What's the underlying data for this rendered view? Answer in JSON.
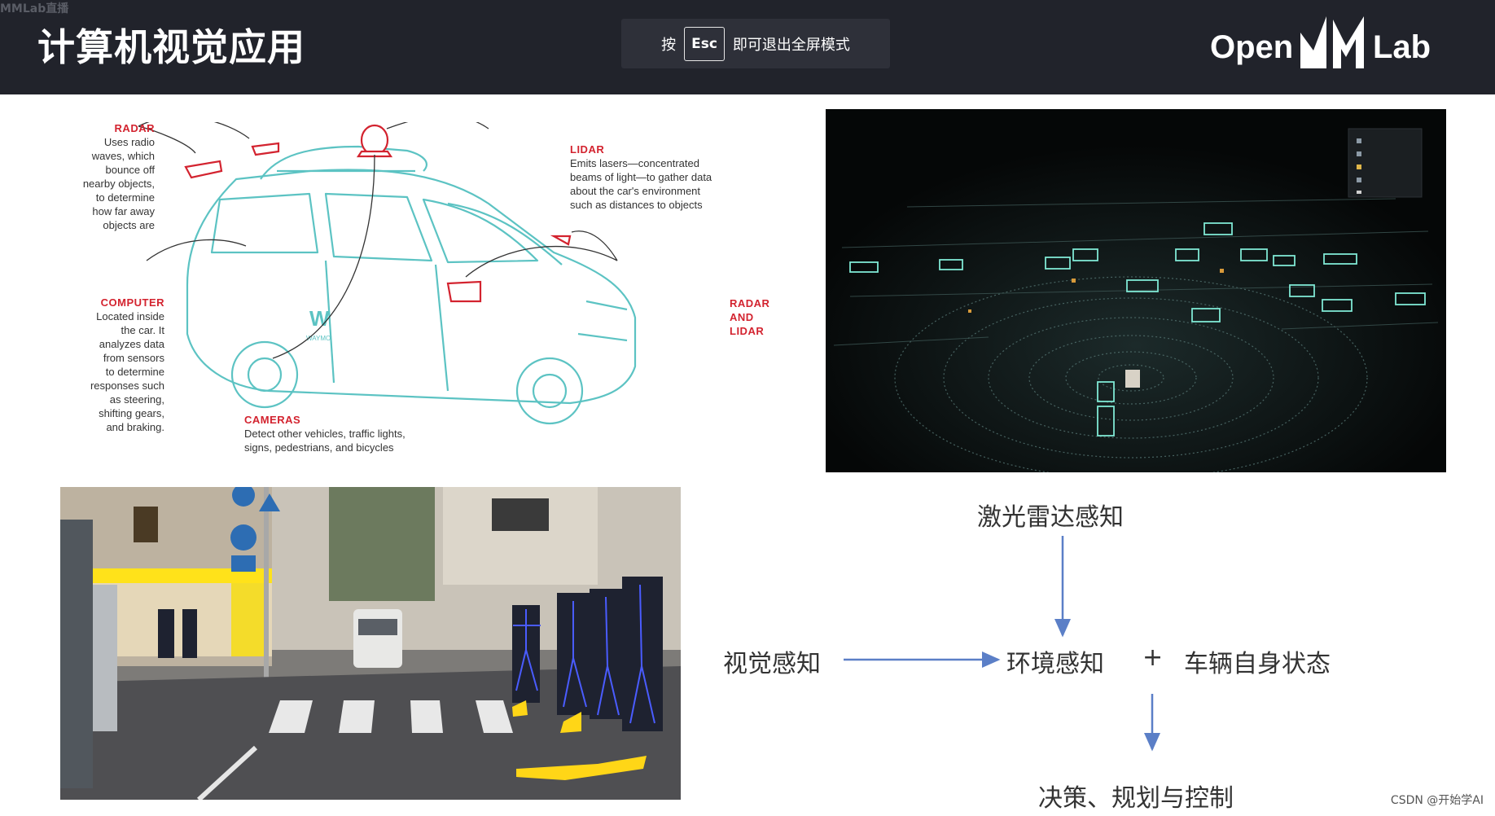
{
  "header": {
    "stamp": "MMLab直播",
    "title": "计算机视觉应用",
    "esc_banner": {
      "before": "按",
      "key": "Esc",
      "after": "即可退出全屏模式"
    },
    "brand": {
      "left": "Open",
      "right": "Lab",
      "mark": "MM"
    }
  },
  "car_diagram": {
    "radar_top": {
      "title": "RADAR",
      "lines": [
        "Uses radio",
        "waves, which",
        "bounce off",
        "nearby objects,",
        "to determine",
        "how far away",
        "objects are"
      ]
    },
    "lidar": {
      "title": "LIDAR",
      "lines": [
        "Emits lasers—concentrated",
        "beams of light—to gather data",
        "about the car's environment",
        "such as distances to objects"
      ]
    },
    "computer": {
      "title": "COMPUTER",
      "lines": [
        "Located inside",
        "the car. It",
        "analyzes data",
        "from sensors",
        "to determine",
        "responses such",
        "as steering,",
        "shifting gears,",
        "and braking."
      ]
    },
    "radar_lidar": {
      "title_lines": [
        "RADAR",
        "AND",
        "LIDAR"
      ]
    },
    "cameras": {
      "title": "CAMERAS",
      "lines": [
        "Detect other vehicles, traffic lights,",
        "signs, pedestrians, and bicycles"
      ]
    },
    "car_logo": "W",
    "car_brand": "WAYMO"
  },
  "flow": {
    "lidar_perception": "激光雷达感知",
    "visual_perception": "视觉感知",
    "environment_perception": "环境感知",
    "plus": "+",
    "vehicle_state": "车辆自身状态",
    "decision": "决策、规划与控制"
  },
  "watermark": "CSDN @开始学AI",
  "colors": {
    "header_bg": "#21232b",
    "callout_red": "#d3232f",
    "car_teal": "#5cc3c3",
    "arrow_blue": "#5b7fc7"
  }
}
